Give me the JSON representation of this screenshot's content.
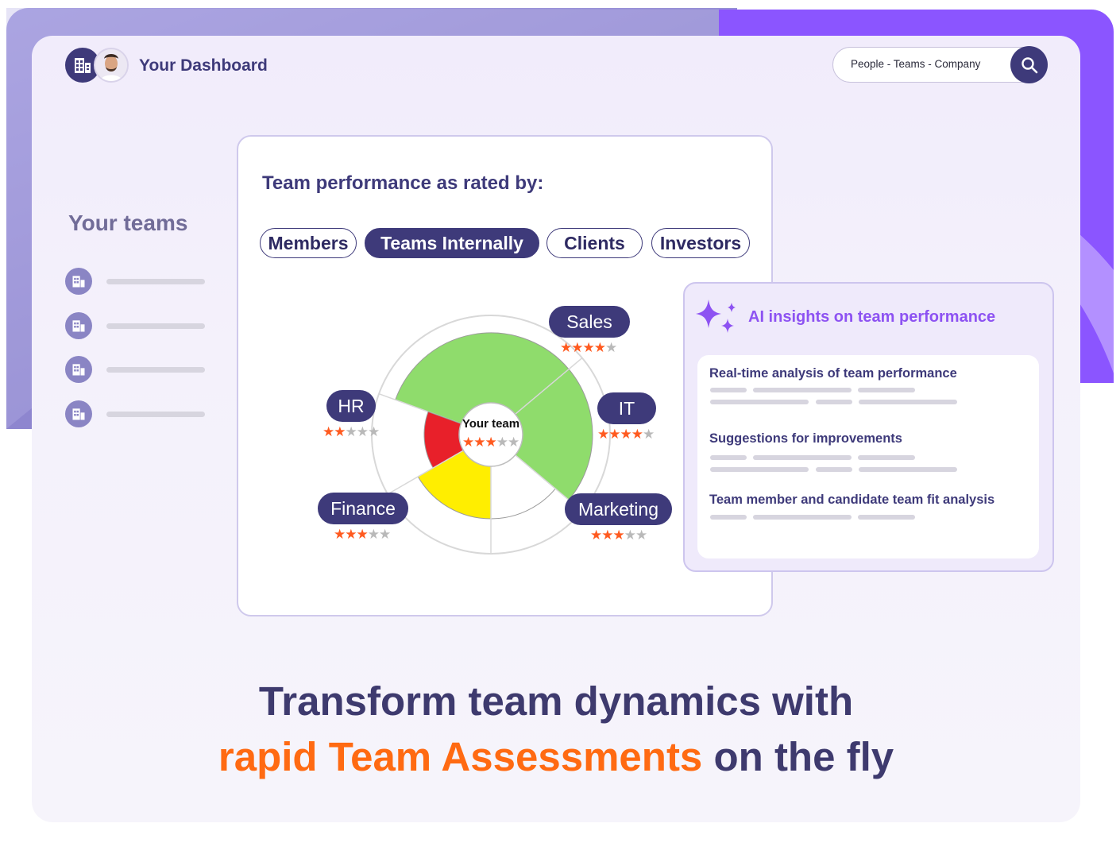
{
  "header": {
    "title": "Your Dashboard",
    "search_text": "People - Teams - Company"
  },
  "sidebar": {
    "title": "Your teams",
    "items": [
      {
        "icon": "building-icon"
      },
      {
        "icon": "building-icon"
      },
      {
        "icon": "building-icon"
      },
      {
        "icon": "building-icon"
      }
    ]
  },
  "performance": {
    "title": "Team performance as rated by:",
    "tabs": [
      {
        "label": "Members",
        "active": false
      },
      {
        "label": "Teams Internally",
        "active": true
      },
      {
        "label": "Clients",
        "active": false
      },
      {
        "label": "Investors",
        "active": false
      }
    ],
    "center": {
      "label": "Your team",
      "rating": 3,
      "max": 5
    },
    "teams": [
      {
        "label": "Sales",
        "rating": 4,
        "max": 5,
        "color": "#8fdc6c"
      },
      {
        "label": "IT",
        "rating": 4,
        "max": 5,
        "color": "#8fdc6c"
      },
      {
        "label": "Marketing",
        "rating": 3,
        "max": 5,
        "color": "#ffffff"
      },
      {
        "label": "Finance",
        "rating": 3,
        "max": 5,
        "color": "#ffee00"
      },
      {
        "label": "HR",
        "rating": 2,
        "max": 5,
        "color": "#e8202a"
      }
    ]
  },
  "ai_insights": {
    "title": "AI insights on team performance",
    "items": [
      {
        "title": "Real-time analysis of team performance"
      },
      {
        "title": "Suggestions for improvements"
      },
      {
        "title": "Team member and candidate team fit analysis"
      }
    ]
  },
  "headline": {
    "line1": "Transform team dynamics with",
    "accent": "rapid Team Assessments",
    "line2_rest": " on the fly"
  },
  "colors": {
    "primary": "#3e3a7a",
    "accent_orange": "#ff6a12",
    "ai_purple": "#8d52f2",
    "star_on": "#ff5a1f",
    "star_off": "#b9b9b9"
  }
}
